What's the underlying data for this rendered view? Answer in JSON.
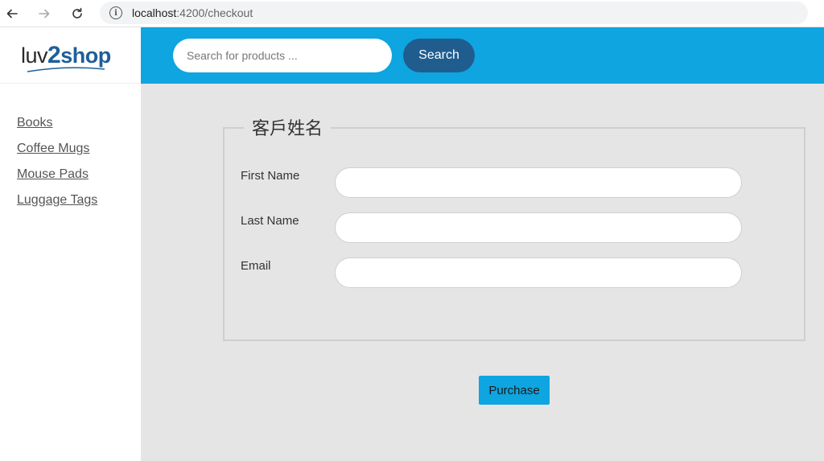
{
  "browser": {
    "url_host": "localhost",
    "url_path": ":4200/checkout"
  },
  "logo": {
    "part1": "luv",
    "part2": "2",
    "part3": "shop"
  },
  "sidebar": {
    "items": [
      {
        "label": "Books"
      },
      {
        "label": "Coffee Mugs"
      },
      {
        "label": "Mouse Pads"
      },
      {
        "label": "Luggage Tags"
      }
    ]
  },
  "header": {
    "search_placeholder": "Search for products ...",
    "search_button": "Search"
  },
  "form": {
    "legend": "客戶姓名",
    "fields": [
      {
        "label": "First Name",
        "value": ""
      },
      {
        "label": "Last Name",
        "value": ""
      },
      {
        "label": "Email",
        "value": ""
      }
    ],
    "purchase_button": "Purchase"
  },
  "colors": {
    "header_bg": "#0ea5e0",
    "search_button_bg": "#205d8f",
    "purchase_button_bg": "#0ea5e0",
    "brand": "#1f5e99"
  },
  "icons": {
    "back": "arrow-left-icon",
    "forward": "arrow-right-icon",
    "reload": "reload-icon",
    "info": "info-icon"
  }
}
